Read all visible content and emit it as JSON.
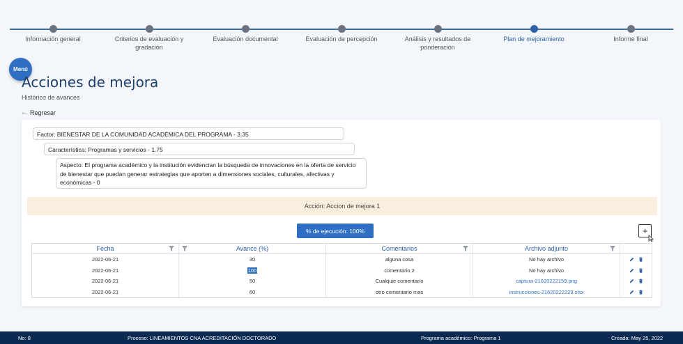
{
  "stepper": {
    "steps": [
      {
        "label": "Información general",
        "active": false
      },
      {
        "label": "Criterios de evaluación y gradación",
        "active": false
      },
      {
        "label": "Evaluación documental",
        "active": false
      },
      {
        "label": "Evaluación de percepción",
        "active": false
      },
      {
        "label": "Análisis y resultados de ponderación",
        "active": false
      },
      {
        "label": "Plan de mejoramiento",
        "active": true
      },
      {
        "label": "Informe final",
        "active": false
      }
    ]
  },
  "menu": {
    "label": "Menú"
  },
  "header": {
    "title": "Acciones de mejora",
    "subtitle": "Histórico de avances",
    "back_label": "Regresar"
  },
  "tree": {
    "factor": "Factor: BIENESTAR DE LA COMUNIDAD ACADÉMICA DEL PROGRAMA - 3.35",
    "caracteristica": "Característica: Programas y servicios - 1.75",
    "aspecto": "Aspecto: El programa académico y la institución evidencian la búsqueda de innovaciones en la oferta de servicio de bienestar que puedan generar estrategias que aporten a dimensiones sociales, culturales, afectivas y económicas - 0"
  },
  "accion": "Acción: Accion de mejora 1",
  "execution_button": "% de ejecución: 100%",
  "add_button": "+",
  "table": {
    "headers": [
      "Fecha",
      "Avance (%)",
      "Comentarios",
      "Archivo adjunto"
    ],
    "rows": [
      {
        "fecha": "2022-06-21",
        "avance": "30",
        "comentario": "alguna cosa",
        "archivo": "No hay archivo",
        "archivo_link": false
      },
      {
        "fecha": "2022-06-21",
        "avance": "100",
        "comentario": "comentario 2",
        "archivo": "No hay archivo",
        "archivo_link": false
      },
      {
        "fecha": "2022-06-21",
        "avance": "50",
        "comentario": "Cualquie comentario",
        "archivo": "captura-21620222159.png",
        "archivo_link": true
      },
      {
        "fecha": "2022-06-21",
        "avance": "60",
        "comentario": "otro comentario mas",
        "archivo": "instrucciones-21620222229.xlsx",
        "archivo_link": true
      }
    ]
  },
  "footer": {
    "no": "No: 8",
    "proceso": "Proceso: LINEAMIENTOS CNA ACREDITACIÓN DOCTORADO",
    "programa": "Programa académico: Programa 1",
    "creada": "Creada: May 25, 2022"
  },
  "colors": {
    "primary": "#2e6fc4",
    "accent_title": "#1f3f6b",
    "accion_bg": "#fbeede",
    "footer_bg": "#0b2a52"
  }
}
